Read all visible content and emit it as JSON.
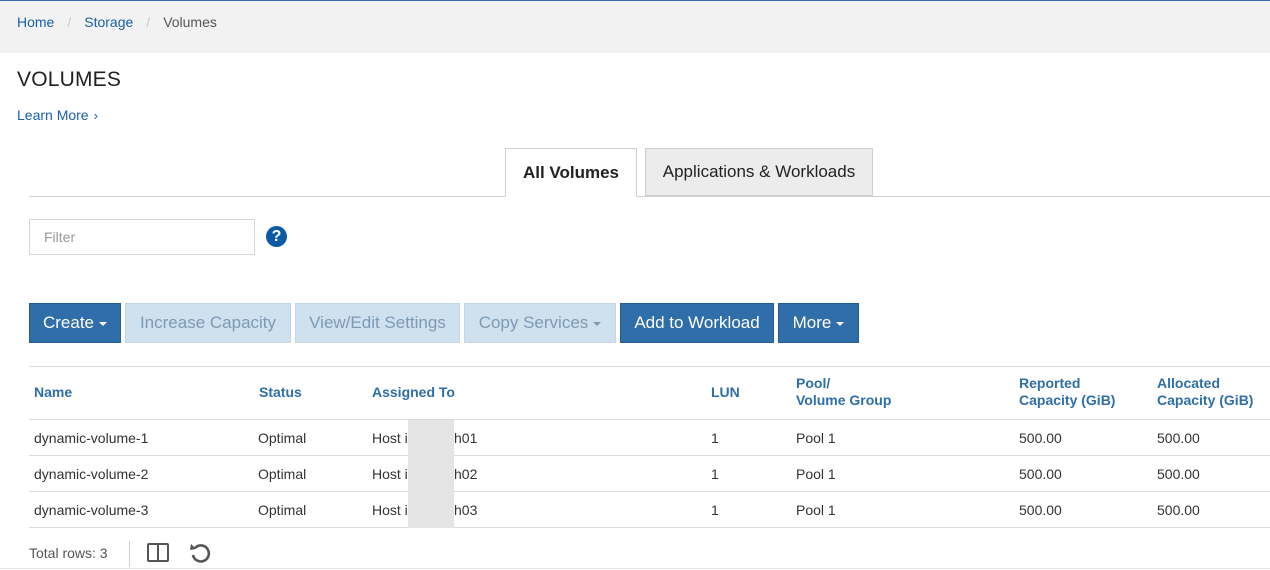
{
  "breadcrumb": {
    "home": "Home",
    "storage": "Storage",
    "current": "Volumes",
    "separator": "/"
  },
  "page": {
    "title": "VOLUMES",
    "learn_more": "Learn More",
    "learn_more_chevron": "›"
  },
  "tabs": {
    "all_volumes": "All Volumes",
    "applications_workloads": "Applications & Workloads"
  },
  "filter": {
    "placeholder": "Filter",
    "value": ""
  },
  "help_icon": "?",
  "toolbar": {
    "create": "Create",
    "increase_capacity": "Increase Capacity",
    "view_edit_settings": "View/Edit Settings",
    "copy_services": "Copy Services",
    "add_to_workload": "Add to Workload",
    "more": "More"
  },
  "table": {
    "headers": {
      "name": "Name",
      "status": "Status",
      "assigned_to": "Assigned To",
      "lun": "LUN",
      "pool_line1": "Pool/",
      "pool_line2": "Volume Group",
      "reported_line1": "Reported",
      "reported_line2": "Capacity (GiB)",
      "allocated_line1": "Allocated",
      "allocated_line2": "Capacity (GiB)"
    },
    "rows": [
      {
        "name": "dynamic-volume-1",
        "status": "Optimal",
        "assigned_prefix": "Host i",
        "assigned_suffix": "h01",
        "lun": "1",
        "pool": "Pool 1",
        "reported": "500.00",
        "allocated": "500.00"
      },
      {
        "name": "dynamic-volume-2",
        "status": "Optimal",
        "assigned_prefix": "Host i",
        "assigned_suffix": "h02",
        "lun": "1",
        "pool": "Pool 1",
        "reported": "500.00",
        "allocated": "500.00"
      },
      {
        "name": "dynamic-volume-3",
        "status": "Optimal",
        "assigned_prefix": "Host i",
        "assigned_suffix": "h03",
        "lun": "1",
        "pool": "Pool 1",
        "reported": "500.00",
        "allocated": "500.00"
      }
    ]
  },
  "footer": {
    "total_rows": "Total rows: 3"
  },
  "colors": {
    "link": "#1a5fa8",
    "primary_button": "#2f6ea8",
    "disabled_button": "#cfe0ee",
    "header_text": "#2f6ea8",
    "help_icon": "#0c5aa6"
  },
  "icons": {
    "columns": "columns-icon",
    "refresh": "refresh-icon",
    "help": "question-circle-icon"
  }
}
